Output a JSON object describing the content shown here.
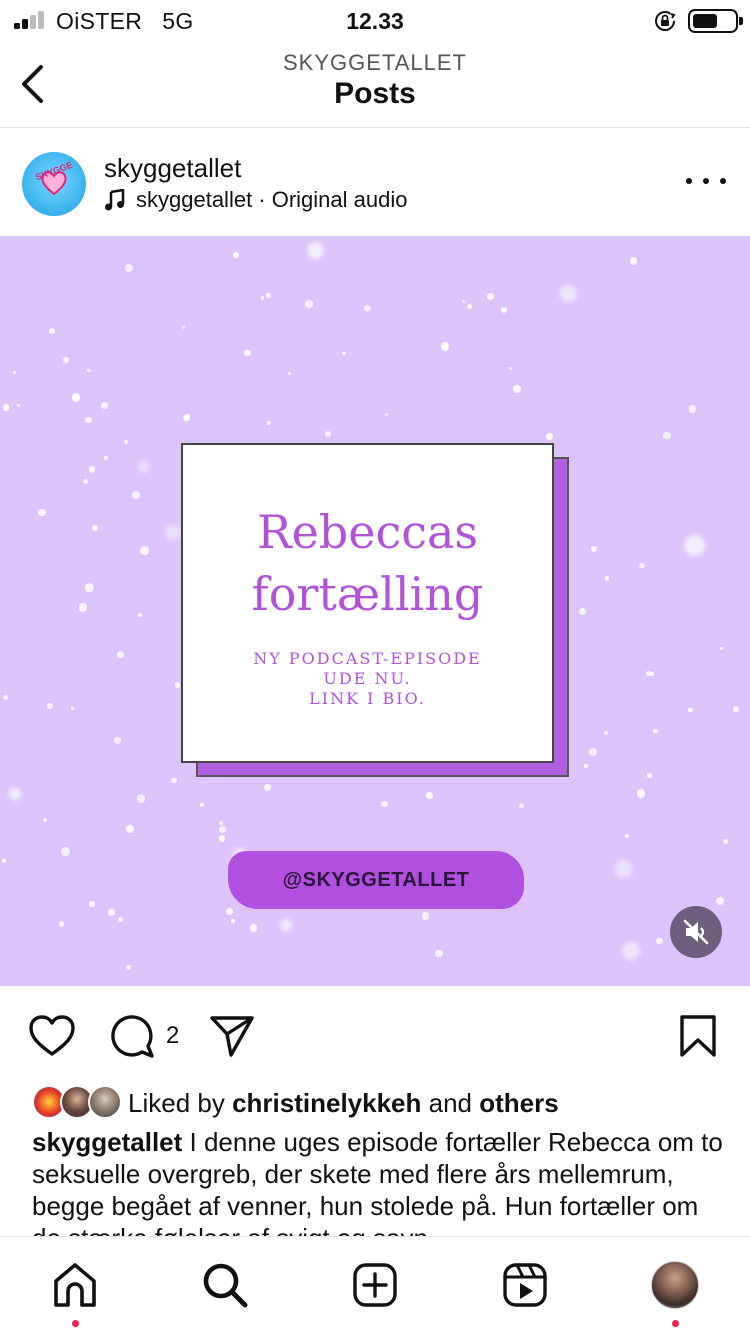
{
  "status_bar": {
    "carrier": "OiSTER",
    "network": "5G",
    "time": "12.33",
    "signal_bars_active": 2,
    "signal_bars_total": 4,
    "battery_level": 0.6,
    "icons": [
      "signal-icon",
      "orientation-lock-icon",
      "battery-icon"
    ]
  },
  "header": {
    "back_icon": "chevron-left-icon",
    "subtitle": "SKYGGETALLET",
    "title": "Posts"
  },
  "post": {
    "username": "skyggetallet",
    "audio_icon": "music-note-icon",
    "audio_text": "skyggetallet · Original audio",
    "more_icon": "more-horizontal-icon",
    "media": {
      "card_title_line1": "Rebeccas",
      "card_title_line2": "fortælling",
      "card_sub_line1": "NY PODCAST-EPISODE",
      "card_sub_line2": "UDE NU.",
      "card_sub_line3": "LINK I BIO.",
      "handle": "@SKYGGETALLET",
      "mute_icon": "speaker-muted-icon",
      "background_color": "#dcc4fb",
      "accent_color": "#b152d9"
    },
    "actions": {
      "like_icon": "heart-icon",
      "comment_icon": "comment-icon",
      "comment_count": "2",
      "share_icon": "send-icon",
      "save_icon": "bookmark-icon"
    },
    "likes": {
      "prefix": "Liked by ",
      "user": "christinelykkeh",
      "middle": " and ",
      "others": "others"
    },
    "caption": {
      "username": "skyggetallet",
      "text": " I denne uges episode fortæller Rebecca om to seksuelle overgreb, der skete med flere års mellemrum, begge begået af venner, hun stolede på. Hun fortæller om de stærke følelser af svigt og savn"
    }
  },
  "bottom_nav": {
    "items": [
      {
        "name": "home",
        "icon": "home-icon",
        "has_dot": true
      },
      {
        "name": "search",
        "icon": "search-icon",
        "has_dot": false
      },
      {
        "name": "create",
        "icon": "plus-square-icon",
        "has_dot": false
      },
      {
        "name": "reels",
        "icon": "reels-icon",
        "has_dot": false
      },
      {
        "name": "profile",
        "icon": "profile-avatar",
        "has_dot": true
      }
    ],
    "dot_color": "#f0224a"
  }
}
